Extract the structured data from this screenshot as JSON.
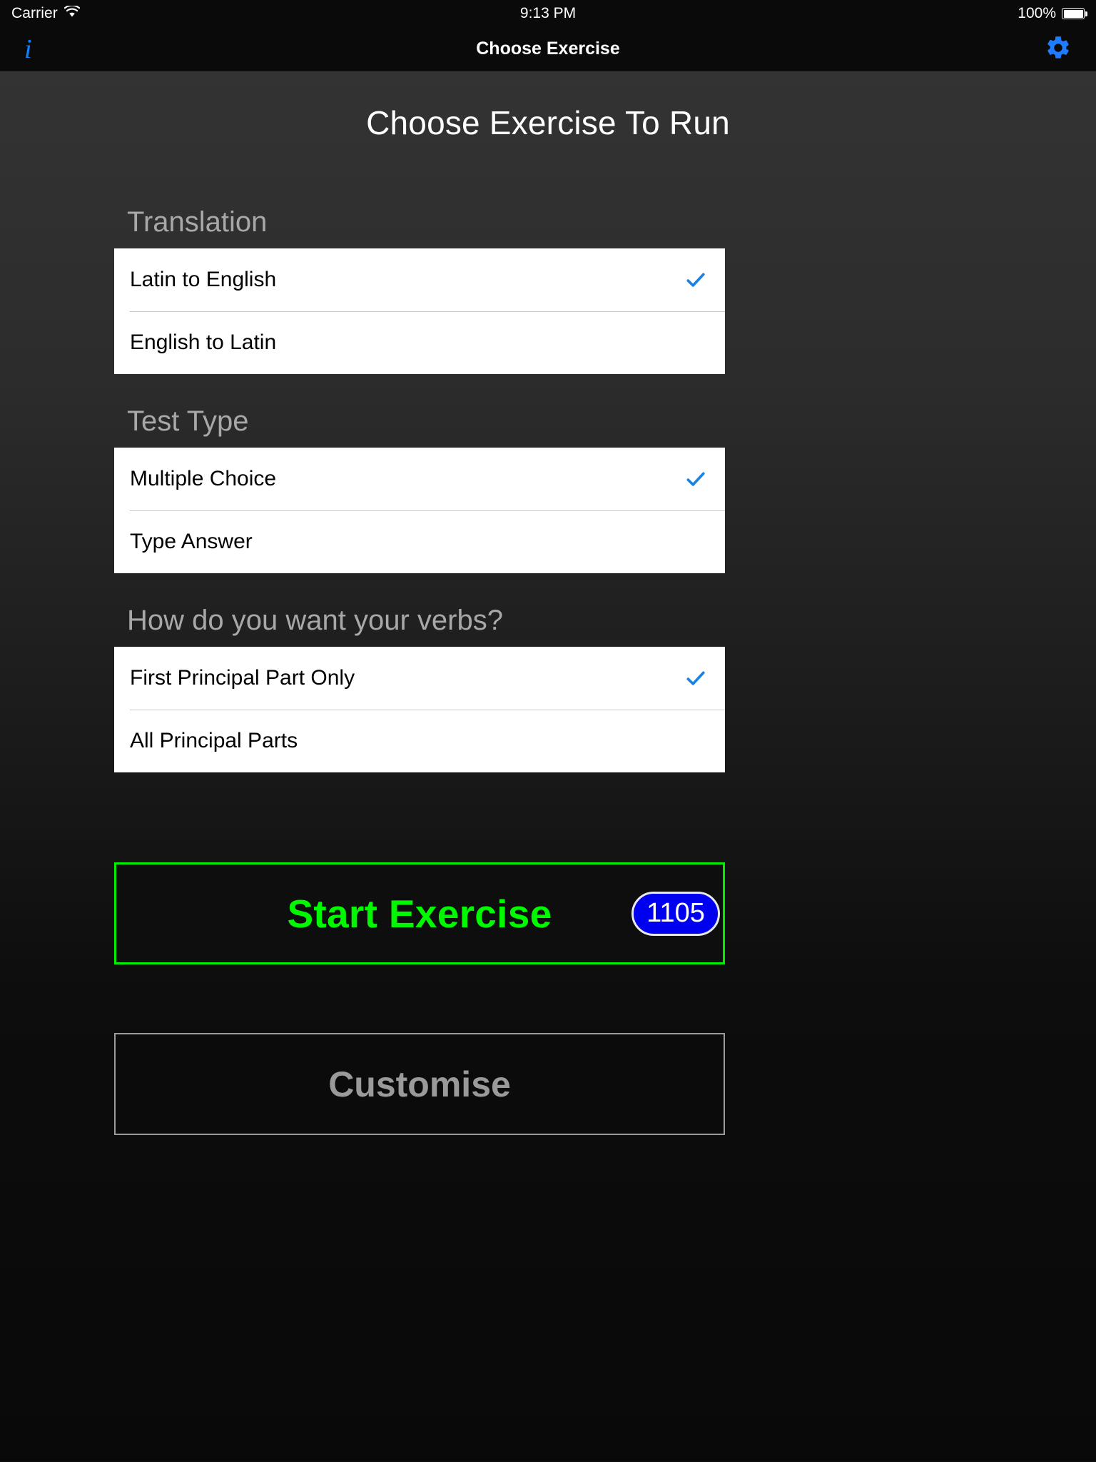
{
  "status_bar": {
    "carrier": "Carrier",
    "wifi_icon": "wifi-icon",
    "time": "9:13 PM",
    "battery_percent": "100%",
    "battery_icon": "battery-full-icon"
  },
  "nav_bar": {
    "info_icon": "info-italic-icon",
    "info_glyph": "i",
    "title": "Choose Exercise",
    "settings_icon": "gear-icon"
  },
  "page": {
    "title": "Choose Exercise To Run"
  },
  "groups": [
    {
      "header": "Translation",
      "options": [
        {
          "label": "Latin to English",
          "selected": true
        },
        {
          "label": "English to Latin",
          "selected": false
        }
      ]
    },
    {
      "header": "Test Type",
      "options": [
        {
          "label": "Multiple Choice",
          "selected": true
        },
        {
          "label": "Type Answer",
          "selected": false
        }
      ]
    },
    {
      "header": "How do you want your verbs?",
      "options": [
        {
          "label": "First Principal Part Only",
          "selected": true
        },
        {
          "label": "All Principal Parts",
          "selected": false
        }
      ]
    }
  ],
  "actions": {
    "start_label": "Start Exercise",
    "start_count": "1105",
    "customise_label": "Customise"
  },
  "colors": {
    "accent_blue": "#0a84ff",
    "check_blue": "#1a82e2",
    "start_green": "#00f900",
    "badge_blue": "#0000f0",
    "customise_gray": "#9a9a9a",
    "header_gray": "#a8a8a8"
  }
}
